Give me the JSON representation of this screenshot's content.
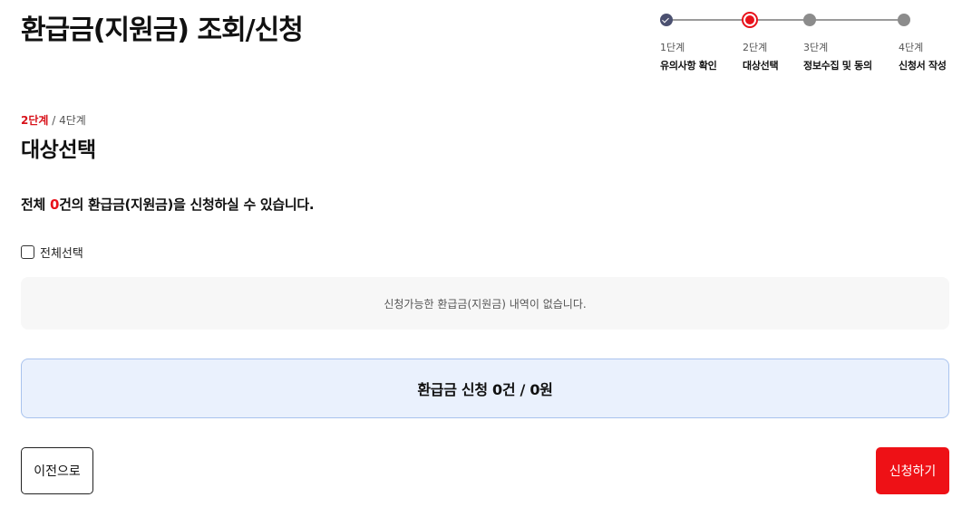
{
  "page": {
    "title": "환급금(지원금) 조회/신청"
  },
  "stepper": {
    "steps": [
      {
        "num": "1단계",
        "label": "유의사항 확인",
        "state": "done"
      },
      {
        "num": "2단계",
        "label": "대상선택",
        "state": "current"
      },
      {
        "num": "3단계",
        "label": "정보수집 및 동의",
        "state": "todo"
      },
      {
        "num": "4단계",
        "label": "신청서 작성",
        "state": "todo"
      }
    ]
  },
  "step_indicator": {
    "current": "2단계",
    "total": " / 4단계"
  },
  "section": {
    "title": "대상선택"
  },
  "summary": {
    "prefix": "전체 ",
    "count": "0",
    "suffix": "건의 환급금(지원금)을 신청하실 수 있습니다."
  },
  "select_all": {
    "label": "전체선택",
    "checked": false
  },
  "empty_message": "신청가능한 환급금(지원금) 내역이 없습니다.",
  "total": {
    "text": "환급금 신청 0건 / 0원"
  },
  "buttons": {
    "prev": "이전으로",
    "apply": "신청하기"
  },
  "colors": {
    "accent": "#e8121b",
    "done": "#4b5070",
    "todo": "#8c8c8c",
    "total_bg": "#eaf1fd",
    "total_border": "#a9c3ee",
    "empty_bg": "#f7f7f7"
  }
}
